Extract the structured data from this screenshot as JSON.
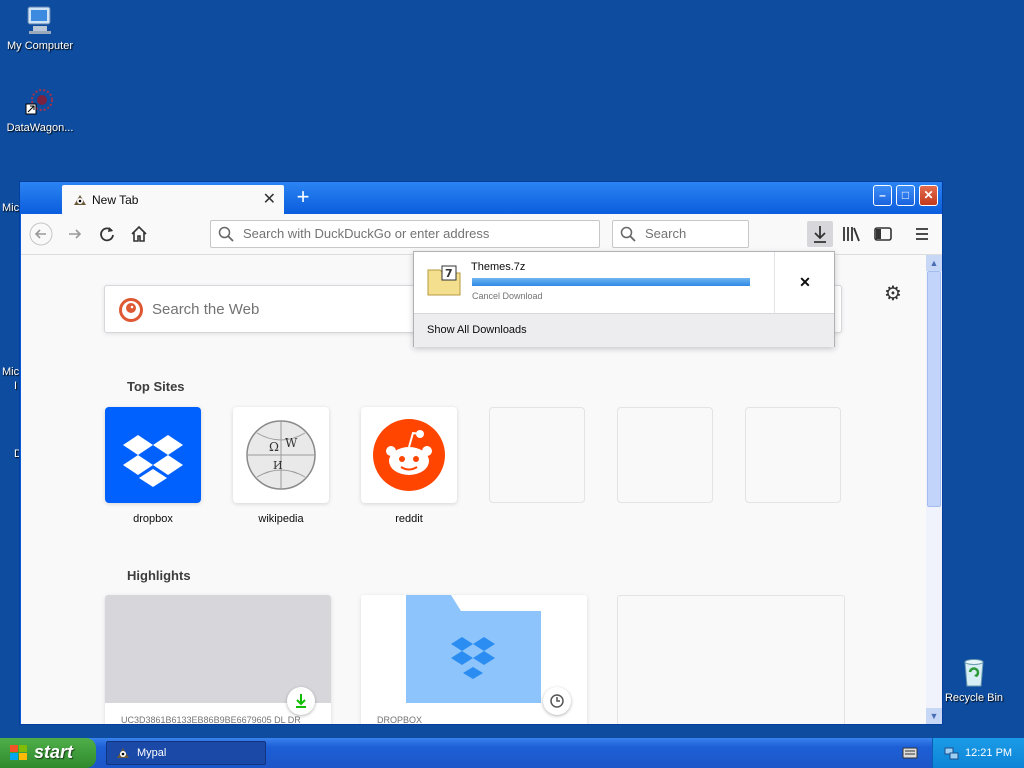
{
  "desktop": {
    "icons": [
      {
        "label": "My Computer"
      },
      {
        "label": "DataWagon..."
      },
      {
        "label": "Recycle Bin"
      }
    ],
    "partial_labels": [
      "Mic",
      "Mic",
      "I",
      "D"
    ]
  },
  "window": {
    "tab": {
      "title": "New Tab"
    },
    "new_tab_label": "+",
    "address_placeholder": "Search with DuckDuckGo or enter address",
    "search_placeholder": "Search"
  },
  "newtab": {
    "websearch_placeholder": "Search the Web",
    "top_sites_heading": "Top Sites",
    "top_sites": [
      {
        "label": "dropbox"
      },
      {
        "label": "wikipedia"
      },
      {
        "label": "reddit"
      }
    ],
    "highlights_heading": "Highlights",
    "highlights": [
      {
        "caption": "UC3D3861B6133EB86B9BE6679605 DL DR"
      },
      {
        "caption": "DROPBOX"
      }
    ]
  },
  "downloads": {
    "file_name": "Themes.7z",
    "progress": 1.0,
    "status_link": "Cancel Download",
    "show_all": "Show All Downloads"
  },
  "taskbar": {
    "start_label": "start",
    "task_label": "Mypal",
    "clock": "12:21 PM"
  },
  "colors": {
    "desktop": "#0d4c9e",
    "dropbox": "#0061fe",
    "reddit": "#ff4500"
  }
}
